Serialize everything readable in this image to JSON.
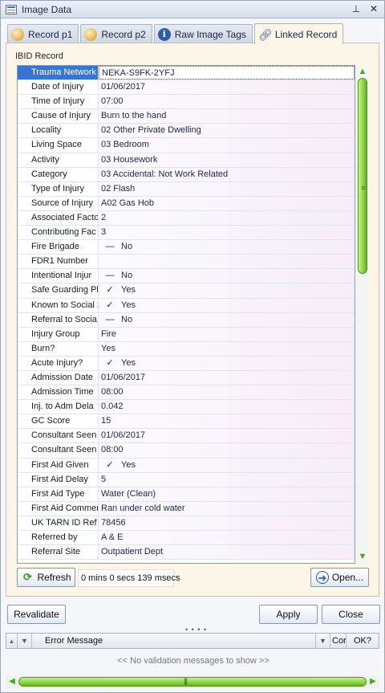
{
  "window": {
    "title": "Image Data",
    "pin_icon": "pin-icon",
    "close_icon": "close-icon"
  },
  "tabs": [
    {
      "label": "Record p1",
      "icon": "database-icon",
      "active": false
    },
    {
      "label": "Record p2",
      "icon": "database-icon",
      "active": false
    },
    {
      "label": "Raw Image Tags",
      "icon": "info-icon",
      "active": false
    },
    {
      "label": "Linked Record",
      "icon": "link-icon",
      "active": true
    }
  ],
  "record": {
    "section_label": "IBID Record",
    "rows": [
      {
        "label": "Trauma Network",
        "value": "NEKA-S9FK-2YFJ",
        "mark": ""
      },
      {
        "label": "Date of Injury",
        "value": "01/06/2017",
        "mark": ""
      },
      {
        "label": "Time of Injury",
        "value": "07:00",
        "mark": ""
      },
      {
        "label": "Cause of Injury",
        "value": "Burn to the hand",
        "mark": ""
      },
      {
        "label": "Locality",
        "value": "02 Other Private Dwelling",
        "mark": ""
      },
      {
        "label": "Living Space",
        "value": "03 Bedroom",
        "mark": ""
      },
      {
        "label": "Activity",
        "value": "03 Housework",
        "mark": ""
      },
      {
        "label": "Category",
        "value": "03 Accidental: Not Work Related",
        "mark": ""
      },
      {
        "label": "Type of Injury",
        "value": "02 Flash",
        "mark": ""
      },
      {
        "label": "Source of Injury",
        "value": "A02 Gas Hob",
        "mark": ""
      },
      {
        "label": "Associated Facto",
        "value": "2",
        "mark": ""
      },
      {
        "label": "Contributing Fac",
        "value": "3",
        "mark": ""
      },
      {
        "label": "Fire Brigade",
        "value": "No",
        "mark": "—"
      },
      {
        "label": "FDR1 Number",
        "value": "",
        "mark": ""
      },
      {
        "label": "Intentional Injur",
        "value": "No",
        "mark": "—"
      },
      {
        "label": "Safe Guarding Pl",
        "value": "Yes",
        "mark": "✓"
      },
      {
        "label": "Known to Social S",
        "value": "Yes",
        "mark": "✓"
      },
      {
        "label": "Referral to Socia",
        "value": "No",
        "mark": "—"
      },
      {
        "label": "Injury Group",
        "value": "Fire",
        "mark": ""
      },
      {
        "label": "Burn?",
        "value": "Yes",
        "mark": ""
      },
      {
        "label": "Acute Injury?",
        "value": "Yes",
        "mark": "✓"
      },
      {
        "label": "Admission Date",
        "value": "01/06/2017",
        "mark": ""
      },
      {
        "label": "Admission Time",
        "value": "08:00",
        "mark": ""
      },
      {
        "label": "Inj. to Adm Dela",
        "value": "0.042",
        "mark": ""
      },
      {
        "label": "GC Score",
        "value": "15",
        "mark": ""
      },
      {
        "label": "Consultant Seen",
        "value": "01/06/2017",
        "mark": ""
      },
      {
        "label": "Consultant Seen",
        "value": "08:00",
        "mark": ""
      },
      {
        "label": "First Aid Given",
        "value": "Yes",
        "mark": "✓"
      },
      {
        "label": "First Aid Delay",
        "value": "5",
        "mark": ""
      },
      {
        "label": "First Aid Type",
        "value": "Water (Clean)",
        "mark": ""
      },
      {
        "label": "First Aid Commer",
        "value": "Ran under cold water",
        "mark": ""
      },
      {
        "label": "UK TARN ID Ref",
        "value": "78456",
        "mark": ""
      },
      {
        "label": "Referred by",
        "value": "A & E",
        "mark": ""
      },
      {
        "label": "Referral Site",
        "value": "Outpatient Dept",
        "mark": ""
      }
    ]
  },
  "actions": {
    "refresh_label": "Refresh",
    "timing": "0 mins 0 secs 139 msecs",
    "open_label": "Open...",
    "revalidate_label": "Revalidate",
    "apply_label": "Apply",
    "close_label": "Close"
  },
  "validation": {
    "col_message": "Error Message",
    "col_cor": "Cor",
    "col_ok": "OK?",
    "empty_text": "<< No validation messages to show >>"
  },
  "colors": {
    "selection": "#3875d0",
    "scroll_green": "#8ed23f",
    "panel_bg": "#fbf6e8"
  }
}
